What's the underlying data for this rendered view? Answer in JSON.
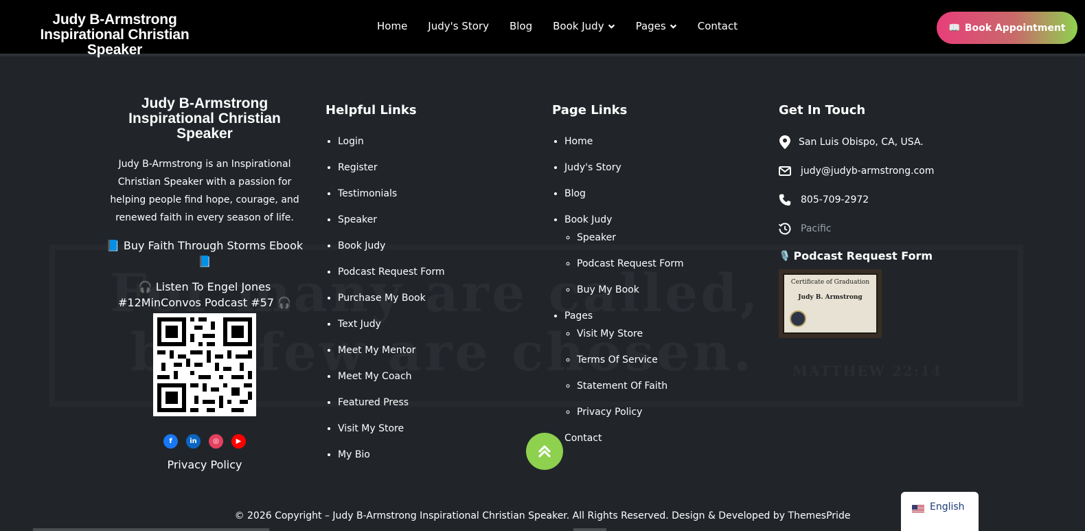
{
  "header": {
    "logo_line1": "Judy B-Armstrong",
    "logo_line2": "Inspirational Christian Speaker",
    "nav": [
      "Home",
      "Judy's Story",
      "Blog",
      "Book Judy",
      "Pages",
      "Contact"
    ],
    "book_button": "Book Appointment",
    "book_icon": "📖"
  },
  "watermark": {
    "line1": "For many are called,",
    "line2": "but few are chosen.",
    "reference": "MATTHEW 22:14"
  },
  "col1": {
    "logo_line1": "Judy B-Armstrong",
    "logo_line2": "Inspirational Christian Speaker",
    "about": "Judy B-Armstrong is an Inspirational Christian Speaker with a passion for helping people find hope, courage, and renewed faith in every season of life.",
    "promo1": "📘 Buy Faith Through Storms Ebook 📘",
    "promo2": "🎧 Listen To Engel Jones #12MinConvos Podcast #57 🎧",
    "privacy": "Privacy Policy"
  },
  "helpful": {
    "title": "Helpful Links",
    "links": [
      "Login",
      "Register",
      "Testimonials",
      "Speaker",
      "Book Judy",
      "Podcast Request Form",
      "Purchase My Book",
      "Text Judy",
      "Meet My Mentor",
      "Meet My Coach",
      "Featured Press",
      "Visit My Store",
      "My Bio"
    ]
  },
  "page_links": {
    "title": "Page Links",
    "home": "Home",
    "story": "Judy's Story",
    "blog": "Blog",
    "book_judy": "Book Judy",
    "book_sub": [
      "Speaker",
      "Podcast Request Form",
      "Buy My Book"
    ],
    "pages": "Pages",
    "pages_sub": [
      "Visit My Store",
      "Terms Of Service",
      "Statement Of Faith",
      "Privacy Policy"
    ],
    "contact": "Contact"
  },
  "contact": {
    "title": "Get In Touch",
    "address": "San Luis Obispo, CA, USA.",
    "email": "judy@judyb-armstrong.com",
    "phone": "805-709-2972",
    "timezone": "Pacific",
    "podcast_title": "Podcast Request Form",
    "podcast_icon": "🎙️",
    "cert_title": "Certificate of Graduation",
    "cert_name": "Judy B. Armstrong"
  },
  "footer": {
    "copyright": "© 2026 Copyright – Judy B-Armstrong Inspirational Christian Speaker. All Rights Reserved. Design & Developed by ThemesPride",
    "language": "English"
  },
  "colors": {
    "background": "#21252a",
    "header": "#000000",
    "accent_green": "#8dd14e",
    "accent_pink": "#e83e7a"
  }
}
